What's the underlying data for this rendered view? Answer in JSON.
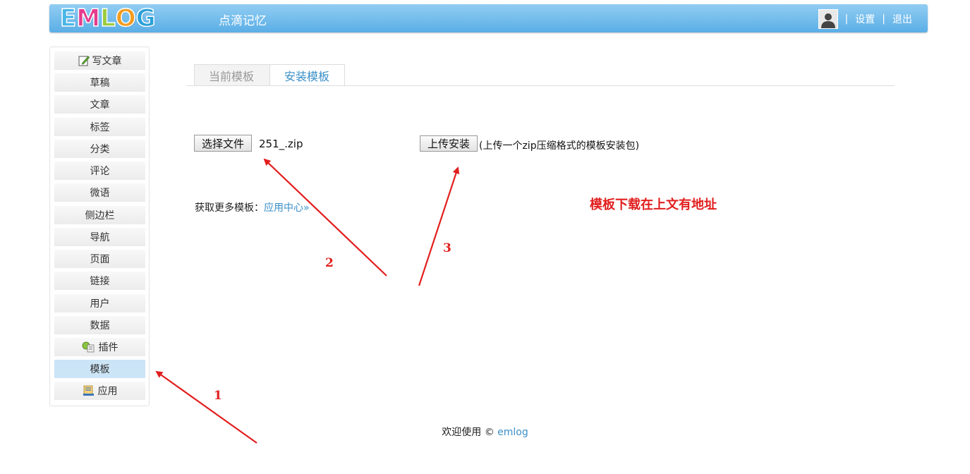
{
  "header": {
    "logo_letters": [
      {
        "ch": "E",
        "color": "#49b6e8"
      },
      {
        "ch": "M",
        "color": "#e53c8e"
      },
      {
        "ch": "L",
        "color": "#9bcc3c"
      },
      {
        "ch": "O",
        "color": "#f39c1f"
      },
      {
        "ch": "G",
        "color": "#2aa0d8"
      }
    ],
    "site_title": "点滴记忆",
    "divider": "|",
    "settings": "设置",
    "logout": "退出"
  },
  "sidebar": {
    "items": [
      {
        "label": "写文章",
        "icon": "pencil-icon"
      },
      {
        "label": "草稿"
      },
      {
        "label": "文章"
      },
      {
        "label": "标签"
      },
      {
        "label": "分类"
      },
      {
        "label": "评论"
      },
      {
        "label": "微语"
      },
      {
        "label": "侧边栏"
      },
      {
        "label": "导航"
      },
      {
        "label": "页面"
      },
      {
        "label": "链接"
      },
      {
        "label": "用户"
      },
      {
        "label": "数据"
      },
      {
        "label": "插件",
        "icon": "plugin-icon"
      },
      {
        "label": "模板",
        "active": true
      },
      {
        "label": "应用",
        "icon": "app-icon"
      }
    ]
  },
  "tabs": {
    "current": "当前模板",
    "install": "安装模板"
  },
  "upload": {
    "choose_file": "选择文件",
    "file_name": "251_.zip",
    "upload_button": "上传安装",
    "hint": "(上传一个zip压缩格式的模板安装包)"
  },
  "more": {
    "label": "获取更多模板：",
    "link": "应用中心»"
  },
  "annotations": {
    "note": "模板下载在上文有地址",
    "n1": "1",
    "n2": "2",
    "n3": "3"
  },
  "footer": {
    "text": "欢迎使用 © ",
    "link": "emlog"
  },
  "colors": {
    "header": "#5aaee6",
    "accent": "#3a8fc7",
    "annotation": "#e21e1e",
    "active_menu": "#cbe4f6"
  }
}
